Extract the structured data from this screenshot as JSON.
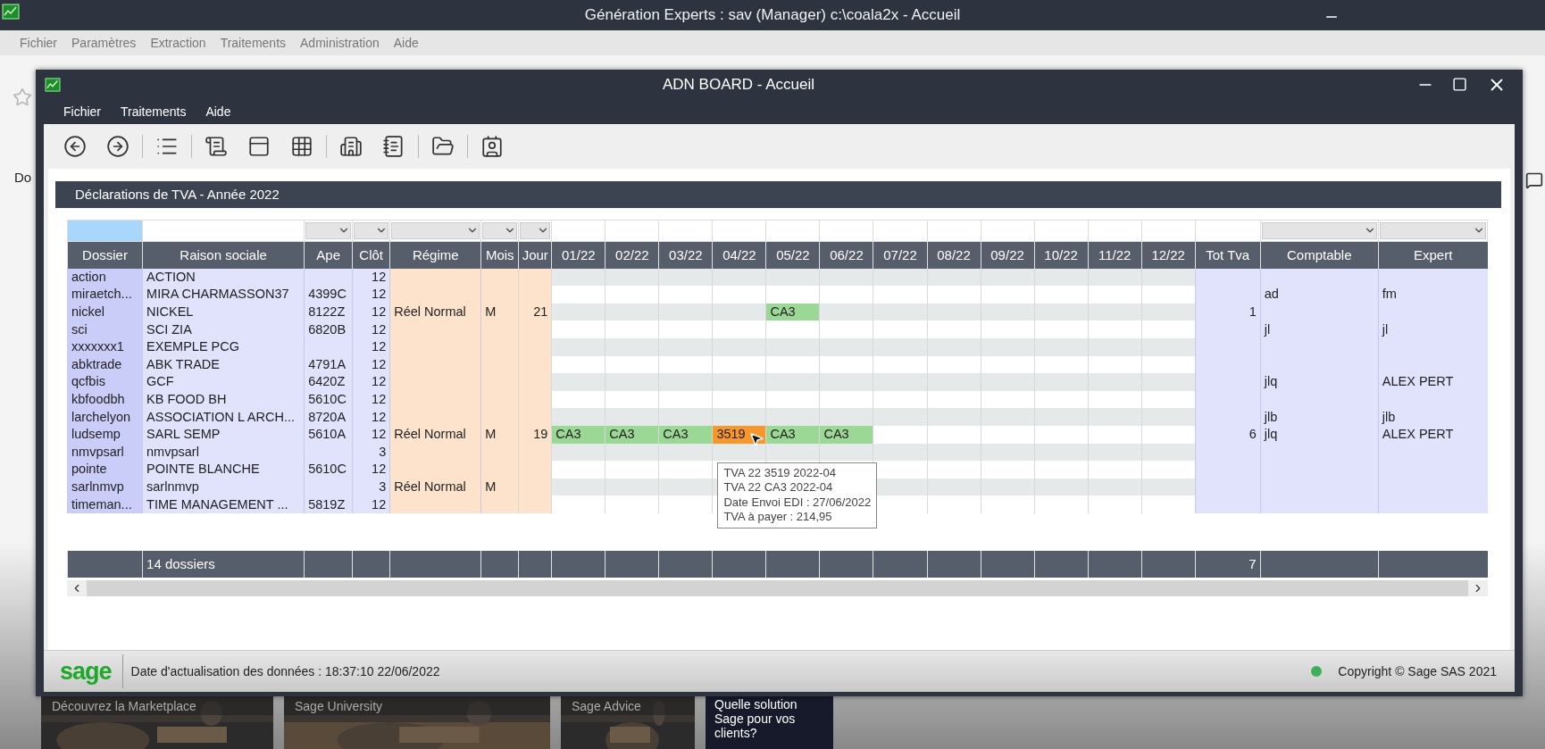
{
  "app_window": {
    "title": "Génération Experts : sav (Manager) c:\\coala2x - Accueil",
    "menu": [
      "Fichier",
      "Paramètres",
      "Extraction",
      "Traitements",
      "Administration",
      "Aide"
    ],
    "side_tab": "Do"
  },
  "window": {
    "title": "ADN BOARD - Accueil",
    "menu": [
      "Fichier",
      "Traitements",
      "Aide"
    ]
  },
  "section": {
    "title": "Déclarations de TVA - Année 2022"
  },
  "columns": [
    {
      "kind": "dossier",
      "label": "Dossier"
    },
    {
      "kind": "raison",
      "label": "Raison sociale",
      "footer": "14 dossiers"
    },
    {
      "kind": "ape",
      "label": "Ape"
    },
    {
      "kind": "clot",
      "label": "Clôt"
    },
    {
      "kind": "regime",
      "label": "Régime"
    },
    {
      "kind": "mois",
      "label": "Mois"
    },
    {
      "kind": "jour",
      "label": "Jour"
    },
    {
      "kind": "month",
      "label": "01/22"
    },
    {
      "kind": "month",
      "label": "02/22"
    },
    {
      "kind": "month",
      "label": "03/22"
    },
    {
      "kind": "month",
      "label": "04/22"
    },
    {
      "kind": "month",
      "label": "05/22"
    },
    {
      "kind": "month",
      "label": "06/22"
    },
    {
      "kind": "month",
      "label": "07/22"
    },
    {
      "kind": "month",
      "label": "08/22"
    },
    {
      "kind": "month",
      "label": "09/22"
    },
    {
      "kind": "month",
      "label": "10/22"
    },
    {
      "kind": "month",
      "label": "11/22"
    },
    {
      "kind": "month",
      "label": "12/22"
    },
    {
      "kind": "tot",
      "label": "Tot Tva",
      "footer": "7"
    },
    {
      "kind": "comptable",
      "label": "Comptable"
    },
    {
      "kind": "expert",
      "label": "Expert"
    }
  ],
  "rows": [
    {
      "dossier": "action",
      "raison": "ACTION",
      "clot": "12"
    },
    {
      "dossier": "miraetch...",
      "raison": "MIRA  CHARMASSON37",
      "ape": "4399C",
      "clot": "12",
      "comptable": "ad",
      "expert": "fm"
    },
    {
      "dossier": "nickel",
      "raison": "NICKEL",
      "ape": "8122Z",
      "clot": "12",
      "regime": "Réel Normal",
      "mois": "M",
      "jour": "21",
      "tot": "1",
      "months": [
        {
          "kind": "none"
        },
        {
          "kind": "none"
        },
        {
          "kind": "none"
        },
        {
          "kind": "none"
        },
        {
          "text": "CA3",
          "kind": "regular"
        }
      ]
    },
    {
      "dossier": "sci",
      "raison": "SCI ZIA",
      "ape": "6820B",
      "clot": "12",
      "comptable": "jl",
      "expert": "jl"
    },
    {
      "dossier": "xxxxxxx1",
      "raison": "EXEMPLE PCG",
      "clot": "12"
    },
    {
      "dossier": "abktrade",
      "raison": "ABK TRADE",
      "ape": "4791A",
      "clot": "12"
    },
    {
      "dossier": "qcfbis",
      "raison": "GCF",
      "ape": "6420Z",
      "clot": "12",
      "comptable": "jlq",
      "expert": "ALEX PERT"
    },
    {
      "dossier": "kbfoodbh",
      "raison": "KB FOOD BH",
      "ape": "5610C",
      "clot": "12"
    },
    {
      "dossier": "larchelyon",
      "raison": "ASSOCIATION L ARCH...",
      "ape": "8720A",
      "clot": "12",
      "comptable": "jlb",
      "expert": "jlb"
    },
    {
      "dossier": "ludsemp",
      "raison": "SARL SEMP",
      "ape": "5610A",
      "clot": "12",
      "regime": "Réel Normal",
      "mois": "M",
      "jour": "19",
      "tot": "6",
      "comptable": "jlq",
      "expert": "ALEX PERT",
      "months": [
        {
          "text": "CA3",
          "kind": "regular"
        },
        {
          "text": "CA3",
          "kind": "regular"
        },
        {
          "text": "CA3",
          "kind": "regular"
        },
        {
          "text": "3519",
          "kind": "refund",
          "tooltip": [
            "TVA 22 3519 2022-04",
            "TVA 22 CA3 2022-04",
            "Date Envoi EDI : 27/06/2022",
            "TVA à payer : 214,95"
          ]
        },
        {
          "text": "CA3",
          "kind": "regular"
        },
        {
          "text": "CA3",
          "kind": "regular"
        }
      ]
    },
    {
      "dossier": "nmvpsarl",
      "raison": "nmvpsarl",
      "clot": "3"
    },
    {
      "dossier": "pointe",
      "raison": "POINTE BLANCHE",
      "ape": "5610C",
      "clot": "12"
    },
    {
      "dossier": "sarlnmvp",
      "raison": "sarlnmvp",
      "clot": "3",
      "regime": "Réel Normal",
      "mois": "M"
    },
    {
      "dossier": "timeman...",
      "raison": "TIME MANAGEMENT ...",
      "ape": "5819Z",
      "clot": "12"
    }
  ],
  "status_bar": {
    "logo": "sage",
    "updated": "Date d'actualisation des données : 18:37:10 22/06/2022",
    "connection": {
      "color": "#3fae5a"
    },
    "copyright": "Copyright © Sage SAS 2021"
  },
  "tiles": [
    {
      "label": "Découvrez la Marketplace",
      "kind": "picture"
    },
    {
      "label": "Sage University",
      "kind": "picture"
    },
    {
      "label": "Sage Advice",
      "kind": "picture"
    },
    {
      "label": "Quelle solution Sage pour vos clients?",
      "kind": "plain"
    }
  ]
}
